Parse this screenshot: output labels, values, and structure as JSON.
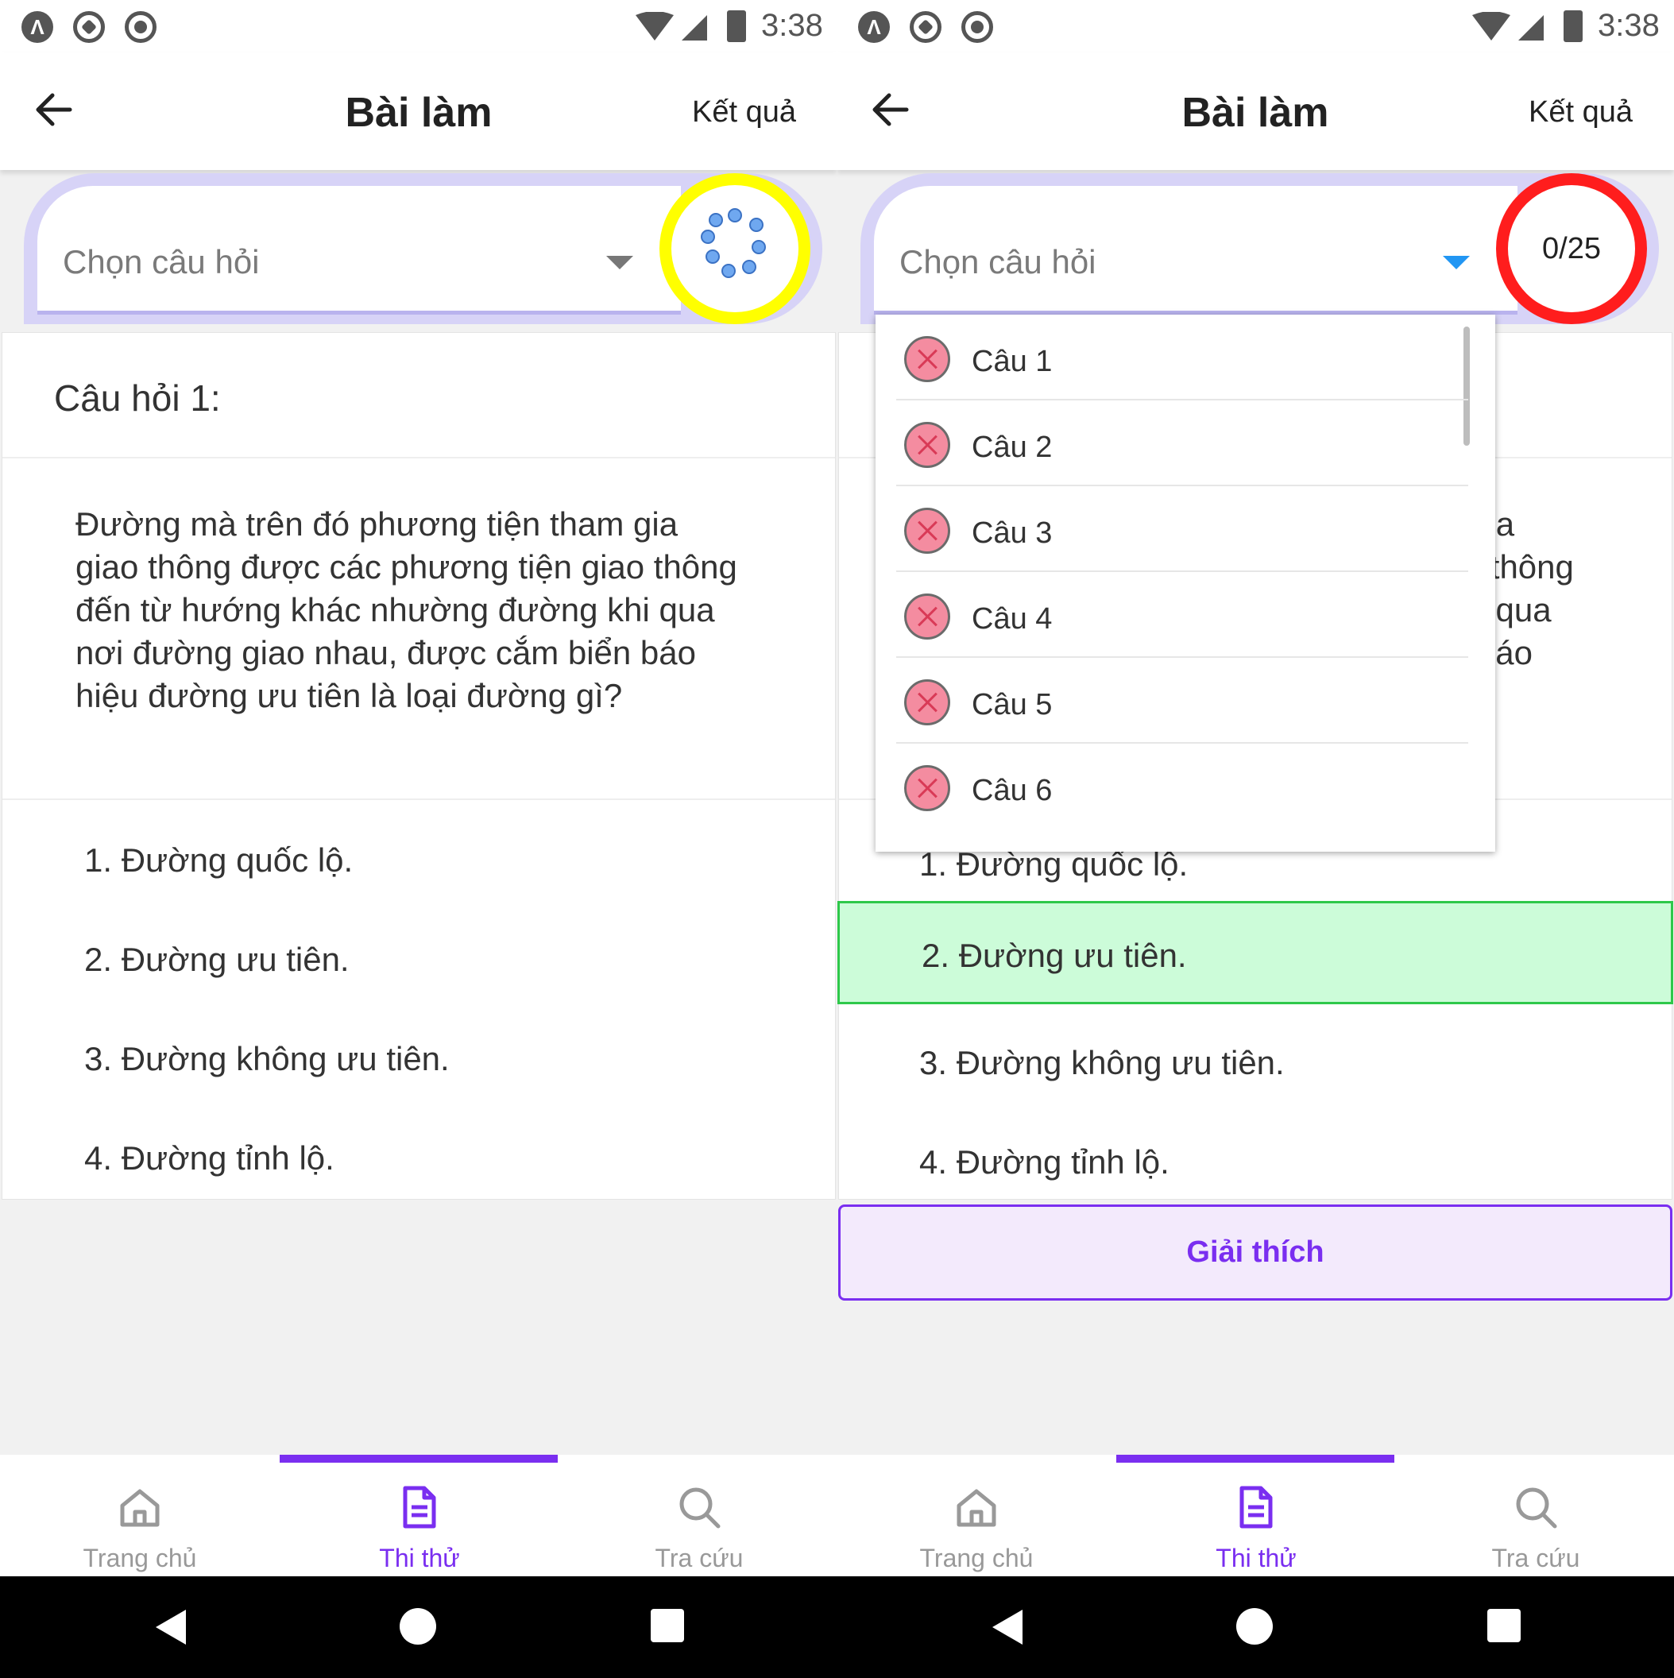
{
  "status_bar": {
    "time": "3:38"
  },
  "app_bar": {
    "title": "Bài làm",
    "action": "Kết quả"
  },
  "selector": {
    "placeholder": "Chọn câu hỏi",
    "progress": "0/25"
  },
  "question": {
    "header": "Câu hỏi 1:",
    "text": "Đường mà trên đó phương tiện tham gia giao thông được các phương tiện giao thông đến từ hướng khác nhường đường khi qua nơi đường giao nhau, được cắm biển báo hiệu đường ưu tiên là loại đường gì?",
    "answers": [
      "1. Đường quốc lộ.",
      "2. Đường ưu tiên.",
      "3. Đường không ưu tiên.",
      "4. Đường tỉnh lộ."
    ],
    "correct_answer_index": 1
  },
  "explain_button": "Giải thích",
  "dropdown_items": [
    "Câu 1",
    "Câu 2",
    "Câu 3",
    "Câu 4",
    "Câu 5",
    "Câu 6"
  ],
  "bottom_nav": [
    {
      "label": "Trang chủ",
      "icon": "home-icon"
    },
    {
      "label": "Thi thử",
      "icon": "document-icon",
      "active": true
    },
    {
      "label": "Tra cứu",
      "icon": "search-icon"
    }
  ],
  "colors": {
    "accent": "#7a2ef0",
    "timer_loading": "#ffff00",
    "timer_active": "#ff1d1d",
    "correct_bg": "#ccfcd9",
    "correct_border": "#2ec84a"
  }
}
